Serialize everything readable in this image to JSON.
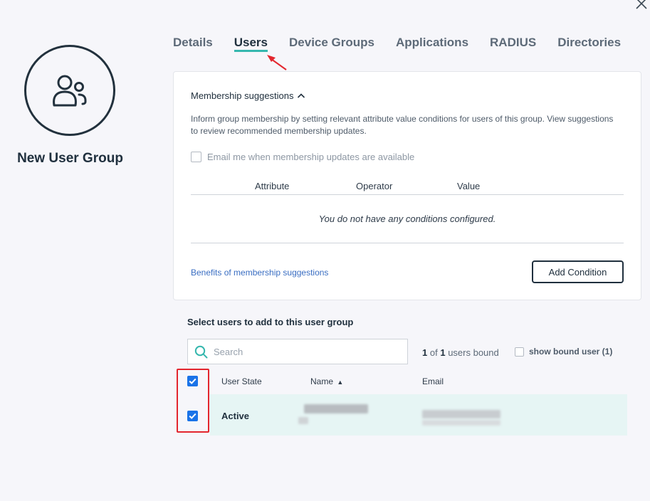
{
  "group": {
    "title": "New User Group",
    "avatar_icon": "users-icon"
  },
  "tabs": [
    {
      "label": "Details",
      "active": false
    },
    {
      "label": "Users",
      "active": true
    },
    {
      "label": "Device Groups",
      "active": false
    },
    {
      "label": "Applications",
      "active": false
    },
    {
      "label": "RADIUS",
      "active": false
    },
    {
      "label": "Directories",
      "active": false
    }
  ],
  "membership": {
    "header": "Membership suggestions",
    "description": "Inform group membership by setting relevant attribute value conditions for users of this group. View suggestions to review recommended membership updates.",
    "email_option": "Email me when membership updates are available",
    "columns": {
      "attribute": "Attribute",
      "operator": "Operator",
      "value": "Value"
    },
    "empty_message": "You do not have any conditions configured.",
    "benefits_link": "Benefits of membership suggestions",
    "add_condition_label": "Add Condition"
  },
  "users": {
    "section_title": "Select users to add to this user group",
    "search_placeholder": "Search",
    "bound_current": "1",
    "bound_of": "of",
    "bound_total": "1",
    "bound_suffix": "users bound",
    "show_bound_label": "show bound user (1)",
    "columns": {
      "state": "User State",
      "name": "Name",
      "email": "Email"
    },
    "sort_indicator": "▲",
    "rows": [
      {
        "state": "Active",
        "selected": true
      }
    ]
  },
  "colors": {
    "accent": "#36b7ae",
    "checkbox": "#1a73e8",
    "highlight": "#e3262e",
    "row_bg": "#e6f5f4"
  }
}
